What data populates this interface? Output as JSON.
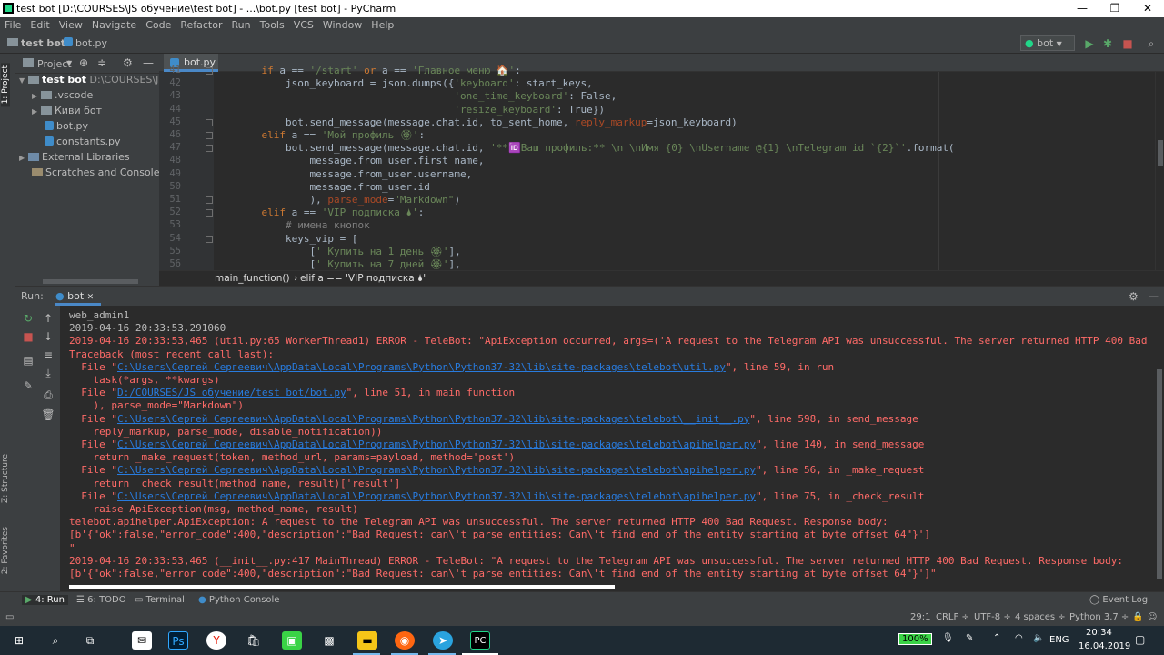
{
  "window": {
    "title": "test bot [D:\\COURSES\\JS обучение\\test bot] - ...\\bot.py [test bot] - PyCharm"
  },
  "menu": [
    "File",
    "Edit",
    "View",
    "Navigate",
    "Code",
    "Refactor",
    "Run",
    "Tools",
    "VCS",
    "Window",
    "Help"
  ],
  "nav": {
    "project": "test bot",
    "file": "bot.py",
    "run_config": "bot"
  },
  "project_panel": {
    "title": "Project",
    "root": "test bot",
    "root_path": "D:\\COURSES\\JS об",
    "items": [
      ".vscode",
      "Киви бот",
      "bot.py",
      "constants.py"
    ],
    "external": "External Libraries",
    "scratches": "Scratches and Consoles"
  },
  "side_tabs": {
    "project": "1: Project",
    "structure": "Z: Structure",
    "favorites": "2: Favorites"
  },
  "editor": {
    "tab": "bot.py",
    "lines": [
      {
        "n": "41",
        "t": "    if a == '/start' or a == 'Главное меню 🏠':"
      },
      {
        "n": "42",
        "t": "        json_keyboard = json.dumps({'keyboard': start_keys,"
      },
      {
        "n": "43",
        "t": "                                    'one_time_keyboard': False,"
      },
      {
        "n": "44",
        "t": "                                    'resize_keyboard': True})"
      },
      {
        "n": "45",
        "t": "        bot.send_message(message.chat.id, to_sent_home, reply_markup=json_keyboard)"
      },
      {
        "n": "46",
        "t": "    elif a == 'Мой профиль 🏵':"
      },
      {
        "n": "47",
        "t": "        bot.send_message(message.chat.id, '**🆔Ваш профиль:** \\n \\nИмя {0} \\nUsername @{1} \\nTelegram id `{2}`'.format("
      },
      {
        "n": "48",
        "t": "            message.from_user.first_name,"
      },
      {
        "n": "49",
        "t": "            message.from_user.username,"
      },
      {
        "n": "50",
        "t": "            message.from_user.id"
      },
      {
        "n": "51",
        "t": "            ), parse_mode=\"Markdown\")"
      },
      {
        "n": "52",
        "t": "    elif a == 'VIP подписка 🌢':"
      },
      {
        "n": "53",
        "t": "        # имена кнопок"
      },
      {
        "n": "54",
        "t": "        keys_vip = ["
      },
      {
        "n": "55",
        "t": "            [' Купить на 1 день 🏵'],"
      },
      {
        "n": "56",
        "t": "            [' Купить на 7 дней 🏵'],"
      }
    ],
    "breadcrumb": [
      "main_function()",
      "elif a == 'VIP подписка 🌢'"
    ]
  },
  "run": {
    "label": "Run:",
    "tab": "bot",
    "lines": [
      {
        "t": "web_admin1",
        "c": ""
      },
      {
        "t": "2019-04-16 20:33:53.291060",
        "c": ""
      },
      {
        "t": "2019-04-16 20:33:53,465 (util.py:65 WorkerThread1) ERROR - TeleBot: \"ApiException occurred, args=('A request to the Telegram API was unsuccessful. The server returned HTTP 400 Bad",
        "c": "er"
      },
      {
        "t": "Traceback (most recent call last):",
        "c": "er"
      },
      {
        "p": "  File \"",
        "l": "C:\\Users\\Сергей Сергеевич\\AppData\\Local\\Programs\\Python\\Python37-32\\lib\\site-packages\\telebot\\util.py",
        "s": "\", line 59, in run",
        "c": "er"
      },
      {
        "t": "    task(*args, **kwargs)",
        "c": "er"
      },
      {
        "p": "  File \"",
        "l": "D:/COURSES/JS обучение/test bot/bot.py",
        "s": "\", line 51, in main_function",
        "c": "er"
      },
      {
        "t": "    ), parse_mode=\"Markdown\")",
        "c": "er"
      },
      {
        "p": "  File \"",
        "l": "C:\\Users\\Сергей Сергеевич\\AppData\\Local\\Programs\\Python\\Python37-32\\lib\\site-packages\\telebot\\__init__.py",
        "s": "\", line 598, in send_message",
        "c": "er"
      },
      {
        "t": "    reply_markup, parse_mode, disable_notification))",
        "c": "er"
      },
      {
        "p": "  File \"",
        "l": "C:\\Users\\Сергей Сергеевич\\AppData\\Local\\Programs\\Python\\Python37-32\\lib\\site-packages\\telebot\\apihelper.py",
        "s": "\", line 140, in send_message",
        "c": "er"
      },
      {
        "t": "    return _make_request(token, method_url, params=payload, method='post')",
        "c": "er"
      },
      {
        "p": "  File \"",
        "l": "C:\\Users\\Сергей Сергеевич\\AppData\\Local\\Programs\\Python\\Python37-32\\lib\\site-packages\\telebot\\apihelper.py",
        "s": "\", line 56, in _make_request",
        "c": "er"
      },
      {
        "t": "    return _check_result(method_name, result)['result']",
        "c": "er"
      },
      {
        "p": "  File \"",
        "l": "C:\\Users\\Сергей Сергеевич\\AppData\\Local\\Programs\\Python\\Python37-32\\lib\\site-packages\\telebot\\apihelper.py",
        "s": "\", line 75, in _check_result",
        "c": "er"
      },
      {
        "t": "    raise ApiException(msg, method_name, result)",
        "c": "er"
      },
      {
        "t": "telebot.apihelper.ApiException: A request to the Telegram API was unsuccessful. The server returned HTTP 400 Bad Request. Response body:",
        "c": "er"
      },
      {
        "t": "[b'{\"ok\":false,\"error_code\":400,\"description\":\"Bad Request: can\\'t parse entities: Can\\'t find end of the entity starting at byte offset 64\"}']",
        "c": "er"
      },
      {
        "t": "\"",
        "c": "er"
      },
      {
        "t": "2019-04-16 20:33:53,465 (__init__.py:417 MainThread) ERROR - TeleBot: \"A request to the Telegram API was unsuccessful. The server returned HTTP 400 Bad Request. Response body:",
        "c": "er"
      },
      {
        "t": "[b'{\"ok\":false,\"error_code\":400,\"description\":\"Bad Request: can\\'t parse entities: Can\\'t find end of the entity starting at byte offset 64\"}']\"",
        "c": "er"
      }
    ]
  },
  "bottom_tabs": [
    "4: Run",
    "6: TODO",
    "Terminal",
    "Python Console"
  ],
  "event_log": "Event Log",
  "status": {
    "pos": "29:1",
    "crlf": "CRLF ÷",
    "enc": "UTF-8 ÷",
    "indent": "4 spaces ÷",
    "py": "Python 3.7 ÷"
  },
  "taskbar": {
    "battery": "100%",
    "lang": "ENG",
    "time": "20:34",
    "date": "16.04.2019"
  }
}
